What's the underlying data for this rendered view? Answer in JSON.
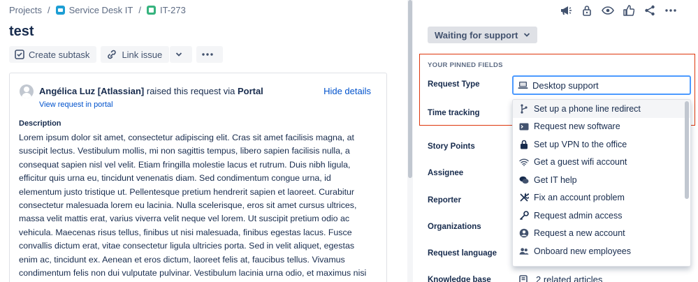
{
  "breadcrumb": {
    "items": [
      "Projects",
      "Service Desk IT",
      "IT-273"
    ],
    "separator": "/"
  },
  "issue": {
    "title": "test"
  },
  "toolbar": {
    "create_subtask": "Create subtask",
    "link_issue": "Link issue"
  },
  "request": {
    "requester": "Angélica Luz [Atlassian]",
    "via_text": "raised this request via",
    "channel": "Portal",
    "view_portal_link": "View request in portal",
    "hide_details": "Hide details"
  },
  "description": {
    "label": "Description",
    "text": "Lorem ipsum dolor sit amet, consectetur adipiscing elit. Cras sit amet facilisis magna, at suscipit lectus. Vestibulum mollis, mi non sagittis tempus, libero sapien facilisis nulla, a consequat sapien nisl vel velit. Etiam fringilla molestie lacus et rutrum. Duis nibh ligula, efficitur quis urna eu, tincidunt venenatis diam. Sed condimentum congue urna, id elementum justo tristique ut. Pellentesque pretium hendrerit sapien et laoreet. Curabitur consectetur malesuada lorem eu lacinia. Nulla scelerisque, eros sit amet cursus ultrices, massa velit mattis erat, varius viverra velit neque vel lorem. Ut suscipit pretium odio ac vehicula. Maecenas risus tellus, finibus ut nisi malesuada, finibus egestas lacus. Fusce convallis dictum erat, vitae consectetur ligula ultricies porta. Sed in velit aliquet, egestas enim ac, tincidunt ex. Aenean et eros dictum, laoreet felis at, faucibus tellus. Vivamus condimentum felis non dui vulputate pulvinar. Vestibulum lacinia urna odio, et maximus nisi tincidunt a."
  },
  "status": {
    "label": "Waiting for support"
  },
  "pinned": {
    "title": "YOUR PINNED FIELDS"
  },
  "fields": {
    "request_type": "Request Type",
    "time_tracking": "Time tracking",
    "story_points": "Story Points",
    "assignee": "Assignee",
    "reporter": "Reporter",
    "organizations": "Organizations",
    "request_language": "Request language",
    "knowledge_base": "Knowledge base"
  },
  "request_type_value": "Desktop support",
  "knowledge_base_value": "2 related articles",
  "dropdown": {
    "options": [
      {
        "label": "Set up a phone line redirect",
        "icon": "branch-icon"
      },
      {
        "label": "Request new software",
        "icon": "terminal-icon"
      },
      {
        "label": "Set up VPN to the office",
        "icon": "lock-icon"
      },
      {
        "label": "Get a guest wifi account",
        "icon": "wifi-icon"
      },
      {
        "label": "Get IT help",
        "icon": "chat-icon"
      },
      {
        "label": "Fix an account problem",
        "icon": "tools-icon"
      },
      {
        "label": "Request admin access",
        "icon": "key-icon"
      },
      {
        "label": "Request a new account",
        "icon": "user-circle-icon"
      },
      {
        "label": "Onboard new employees",
        "icon": "people-icon"
      }
    ]
  },
  "colors": {
    "link": "#0052cc",
    "highlight_border": "#de350b",
    "focus_border": "#4c9aff"
  }
}
